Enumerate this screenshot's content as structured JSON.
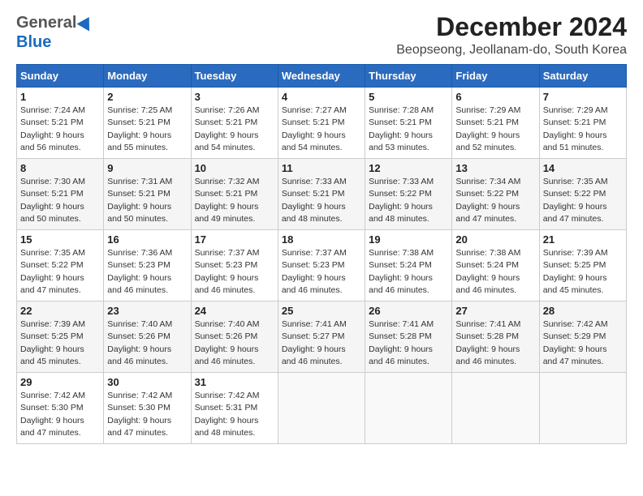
{
  "header": {
    "logo_line1": "General",
    "logo_line2": "Blue",
    "month": "December 2024",
    "location": "Beopseong, Jeollanam-do, South Korea"
  },
  "days_of_week": [
    "Sunday",
    "Monday",
    "Tuesday",
    "Wednesday",
    "Thursday",
    "Friday",
    "Saturday"
  ],
  "weeks": [
    [
      {
        "day": "1",
        "sunrise": "Sunrise: 7:24 AM",
        "sunset": "Sunset: 5:21 PM",
        "daylight": "Daylight: 9 hours and 56 minutes."
      },
      {
        "day": "2",
        "sunrise": "Sunrise: 7:25 AM",
        "sunset": "Sunset: 5:21 PM",
        "daylight": "Daylight: 9 hours and 55 minutes."
      },
      {
        "day": "3",
        "sunrise": "Sunrise: 7:26 AM",
        "sunset": "Sunset: 5:21 PM",
        "daylight": "Daylight: 9 hours and 54 minutes."
      },
      {
        "day": "4",
        "sunrise": "Sunrise: 7:27 AM",
        "sunset": "Sunset: 5:21 PM",
        "daylight": "Daylight: 9 hours and 54 minutes."
      },
      {
        "day": "5",
        "sunrise": "Sunrise: 7:28 AM",
        "sunset": "Sunset: 5:21 PM",
        "daylight": "Daylight: 9 hours and 53 minutes."
      },
      {
        "day": "6",
        "sunrise": "Sunrise: 7:29 AM",
        "sunset": "Sunset: 5:21 PM",
        "daylight": "Daylight: 9 hours and 52 minutes."
      },
      {
        "day": "7",
        "sunrise": "Sunrise: 7:29 AM",
        "sunset": "Sunset: 5:21 PM",
        "daylight": "Daylight: 9 hours and 51 minutes."
      }
    ],
    [
      {
        "day": "8",
        "sunrise": "Sunrise: 7:30 AM",
        "sunset": "Sunset: 5:21 PM",
        "daylight": "Daylight: 9 hours and 50 minutes."
      },
      {
        "day": "9",
        "sunrise": "Sunrise: 7:31 AM",
        "sunset": "Sunset: 5:21 PM",
        "daylight": "Daylight: 9 hours and 50 minutes."
      },
      {
        "day": "10",
        "sunrise": "Sunrise: 7:32 AM",
        "sunset": "Sunset: 5:21 PM",
        "daylight": "Daylight: 9 hours and 49 minutes."
      },
      {
        "day": "11",
        "sunrise": "Sunrise: 7:33 AM",
        "sunset": "Sunset: 5:21 PM",
        "daylight": "Daylight: 9 hours and 48 minutes."
      },
      {
        "day": "12",
        "sunrise": "Sunrise: 7:33 AM",
        "sunset": "Sunset: 5:22 PM",
        "daylight": "Daylight: 9 hours and 48 minutes."
      },
      {
        "day": "13",
        "sunrise": "Sunrise: 7:34 AM",
        "sunset": "Sunset: 5:22 PM",
        "daylight": "Daylight: 9 hours and 47 minutes."
      },
      {
        "day": "14",
        "sunrise": "Sunrise: 7:35 AM",
        "sunset": "Sunset: 5:22 PM",
        "daylight": "Daylight: 9 hours and 47 minutes."
      }
    ],
    [
      {
        "day": "15",
        "sunrise": "Sunrise: 7:35 AM",
        "sunset": "Sunset: 5:22 PM",
        "daylight": "Daylight: 9 hours and 47 minutes."
      },
      {
        "day": "16",
        "sunrise": "Sunrise: 7:36 AM",
        "sunset": "Sunset: 5:23 PM",
        "daylight": "Daylight: 9 hours and 46 minutes."
      },
      {
        "day": "17",
        "sunrise": "Sunrise: 7:37 AM",
        "sunset": "Sunset: 5:23 PM",
        "daylight": "Daylight: 9 hours and 46 minutes."
      },
      {
        "day": "18",
        "sunrise": "Sunrise: 7:37 AM",
        "sunset": "Sunset: 5:23 PM",
        "daylight": "Daylight: 9 hours and 46 minutes."
      },
      {
        "day": "19",
        "sunrise": "Sunrise: 7:38 AM",
        "sunset": "Sunset: 5:24 PM",
        "daylight": "Daylight: 9 hours and 46 minutes."
      },
      {
        "day": "20",
        "sunrise": "Sunrise: 7:38 AM",
        "sunset": "Sunset: 5:24 PM",
        "daylight": "Daylight: 9 hours and 46 minutes."
      },
      {
        "day": "21",
        "sunrise": "Sunrise: 7:39 AM",
        "sunset": "Sunset: 5:25 PM",
        "daylight": "Daylight: 9 hours and 45 minutes."
      }
    ],
    [
      {
        "day": "22",
        "sunrise": "Sunrise: 7:39 AM",
        "sunset": "Sunset: 5:25 PM",
        "daylight": "Daylight: 9 hours and 45 minutes."
      },
      {
        "day": "23",
        "sunrise": "Sunrise: 7:40 AM",
        "sunset": "Sunset: 5:26 PM",
        "daylight": "Daylight: 9 hours and 46 minutes."
      },
      {
        "day": "24",
        "sunrise": "Sunrise: 7:40 AM",
        "sunset": "Sunset: 5:26 PM",
        "daylight": "Daylight: 9 hours and 46 minutes."
      },
      {
        "day": "25",
        "sunrise": "Sunrise: 7:41 AM",
        "sunset": "Sunset: 5:27 PM",
        "daylight": "Daylight: 9 hours and 46 minutes."
      },
      {
        "day": "26",
        "sunrise": "Sunrise: 7:41 AM",
        "sunset": "Sunset: 5:28 PM",
        "daylight": "Daylight: 9 hours and 46 minutes."
      },
      {
        "day": "27",
        "sunrise": "Sunrise: 7:41 AM",
        "sunset": "Sunset: 5:28 PM",
        "daylight": "Daylight: 9 hours and 46 minutes."
      },
      {
        "day": "28",
        "sunrise": "Sunrise: 7:42 AM",
        "sunset": "Sunset: 5:29 PM",
        "daylight": "Daylight: 9 hours and 47 minutes."
      }
    ],
    [
      {
        "day": "29",
        "sunrise": "Sunrise: 7:42 AM",
        "sunset": "Sunset: 5:30 PM",
        "daylight": "Daylight: 9 hours and 47 minutes."
      },
      {
        "day": "30",
        "sunrise": "Sunrise: 7:42 AM",
        "sunset": "Sunset: 5:30 PM",
        "daylight": "Daylight: 9 hours and 47 minutes."
      },
      {
        "day": "31",
        "sunrise": "Sunrise: 7:42 AM",
        "sunset": "Sunset: 5:31 PM",
        "daylight": "Daylight: 9 hours and 48 minutes."
      },
      null,
      null,
      null,
      null
    ]
  ]
}
